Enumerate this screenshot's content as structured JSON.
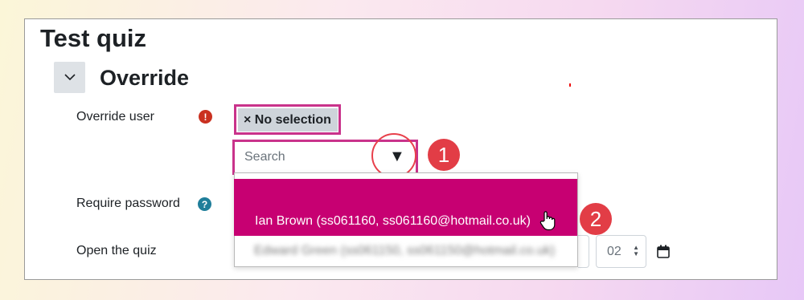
{
  "quiz": {
    "title": "Test quiz"
  },
  "section": {
    "title": "Override",
    "toggle_icon": "chevron-down-icon"
  },
  "override_user": {
    "label": "Override user",
    "required_icon": "!",
    "chip_label": "× No selection",
    "search_placeholder": "Search",
    "toggle_arrow": "▼"
  },
  "dropdown": {
    "options": [
      "Ian Brown (ss061160, ss061160@hotmail.co.uk)",
      "Edward Green (ss061150, ss061150@hotmail.co.uk)"
    ]
  },
  "require_password": {
    "label": "Require password",
    "help_icon": "?"
  },
  "open_quiz": {
    "label": "Open the quiz",
    "minute": "02"
  },
  "annotations": {
    "step1": "1",
    "step2": "2"
  },
  "colors": {
    "highlight": "#c70072",
    "annotation": "#e23d46",
    "outline": "#c9338b"
  }
}
